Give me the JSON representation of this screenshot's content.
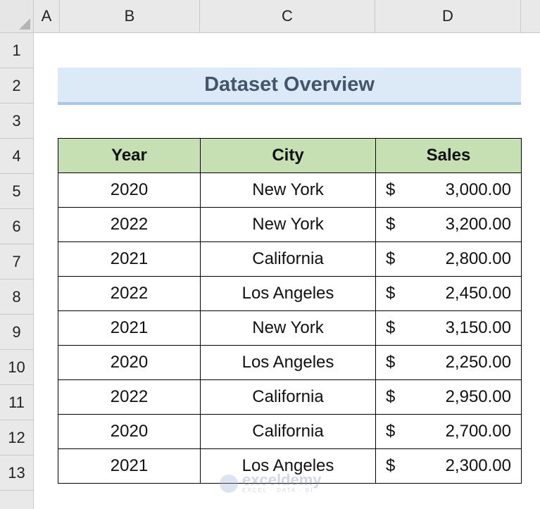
{
  "columns": [
    "A",
    "B",
    "C",
    "D"
  ],
  "rows": [
    "1",
    "2",
    "3",
    "4",
    "5",
    "6",
    "7",
    "8",
    "9",
    "10",
    "11",
    "12",
    "13"
  ],
  "title": "Dataset Overview",
  "table": {
    "headers": [
      "Year",
      "City",
      "Sales"
    ],
    "currency_symbol": "$",
    "rows": [
      {
        "year": "2020",
        "city": "New York",
        "sales": "3,000.00"
      },
      {
        "year": "2022",
        "city": "New York",
        "sales": "3,200.00"
      },
      {
        "year": "2021",
        "city": "California",
        "sales": "2,800.00"
      },
      {
        "year": "2022",
        "city": "Los Angeles",
        "sales": "2,450.00"
      },
      {
        "year": "2021",
        "city": "New York",
        "sales": "3,150.00"
      },
      {
        "year": "2020",
        "city": "Los Angeles",
        "sales": "2,250.00"
      },
      {
        "year": "2022",
        "city": "California",
        "sales": "2,950.00"
      },
      {
        "year": "2020",
        "city": "California",
        "sales": "2,700.00"
      },
      {
        "year": "2021",
        "city": "Los Angeles",
        "sales": "2,300.00"
      }
    ]
  },
  "watermark": {
    "name": "exceldemy",
    "tagline": "EXCEL · DATA · BI"
  },
  "colors": {
    "header_fill": "#c6e0b4",
    "title_fill": "#dce9f6",
    "title_text": "#44546a"
  }
}
